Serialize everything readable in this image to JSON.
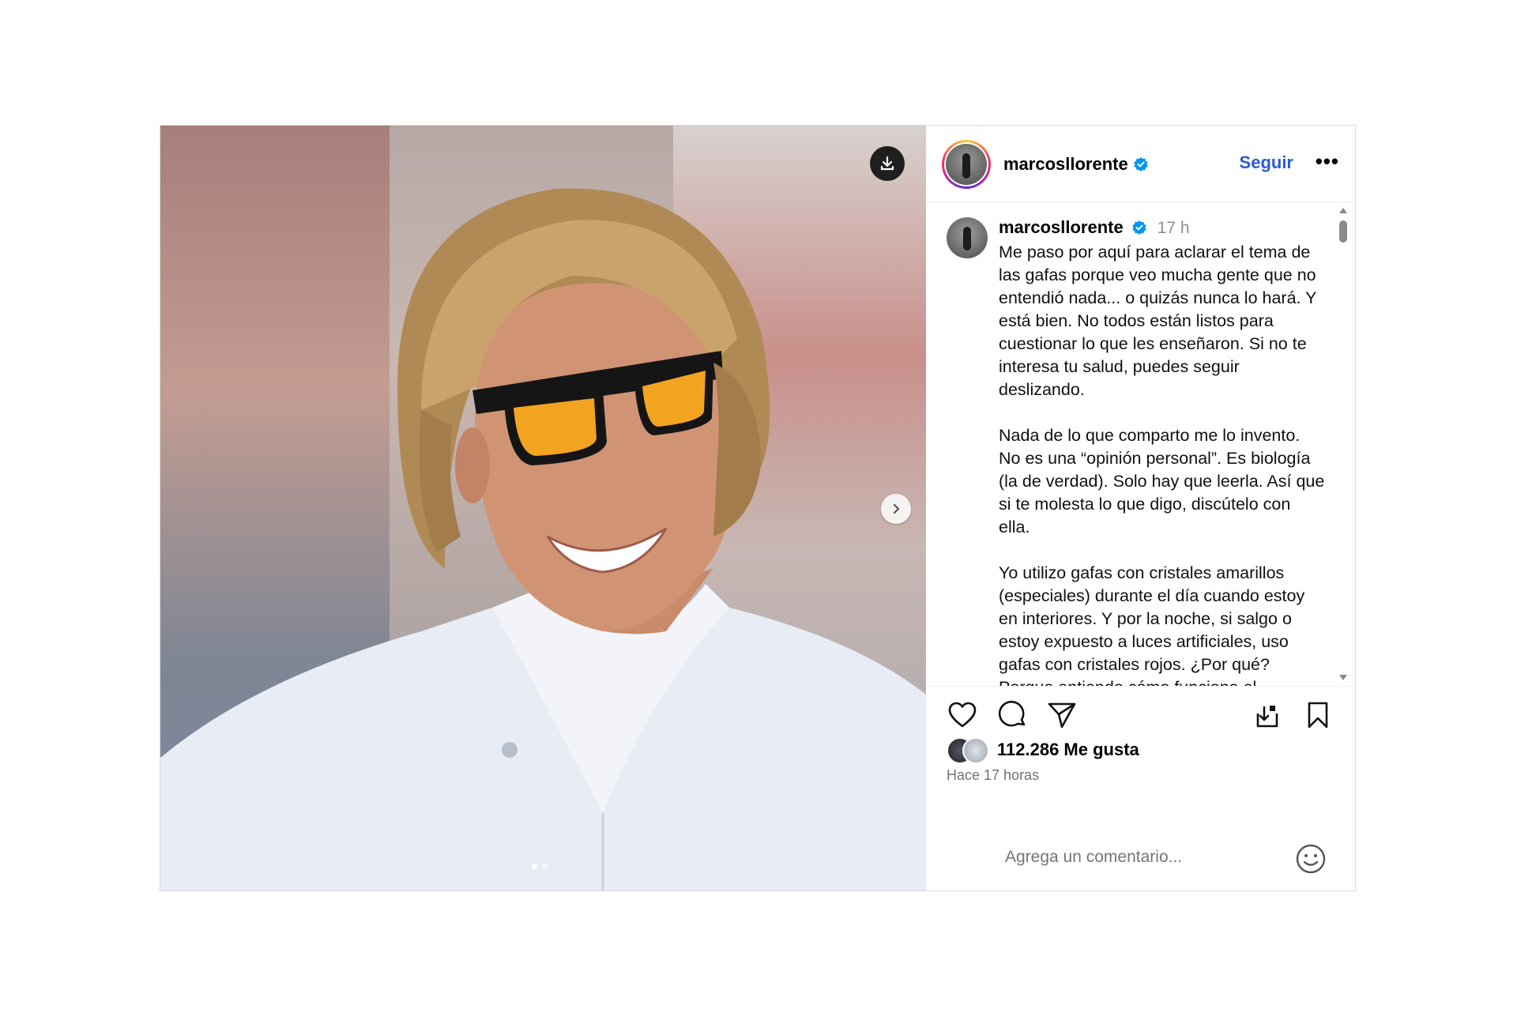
{
  "post": {
    "username": "marcosllorente",
    "follow_label": "Seguir",
    "more_label": "•••",
    "caption": {
      "username": "marcosllorente",
      "time": "17 h",
      "text": "Me paso por aquí para aclarar el tema de las gafas porque veo mucha gente que no entendió nada... o quizás nunca lo hará. Y está bien. No todos están listos para cuestionar lo que les enseñaron. Si no te interesa tu salud, puedes seguir deslizando.\n\nNada de lo que comparto me lo invento. No es una “opinión personal”. Es biología (la de verdad). Solo hay que leerla. Así que si te molesta lo que digo, discútelo con ella.\n\nYo utilizo gafas con cristales amarillos (especiales) durante el día cuando estoy en interiores. Y por la noche, si salgo o estoy expuesto a luces artificiales, uso gafas con cristales rojos. ¿Por qué?\nPorque entiendo cómo funciona el cuerpo..."
    },
    "likes_label": "112.286 Me gusta",
    "timestamp": "Hace 17 horas",
    "comment_placeholder": "Agrega un comentario...",
    "carousel": {
      "current": 1,
      "total": 2
    }
  },
  "colors": {
    "follow": "#2b5ad6",
    "verified": "#0095f6",
    "muted": "#737373"
  },
  "icons": [
    "download-icon",
    "chevron-right-icon",
    "verified-badge-icon",
    "heart-icon",
    "comment-icon",
    "share-icon",
    "save-to-collection-icon",
    "bookmark-icon",
    "emoji-icon"
  ]
}
